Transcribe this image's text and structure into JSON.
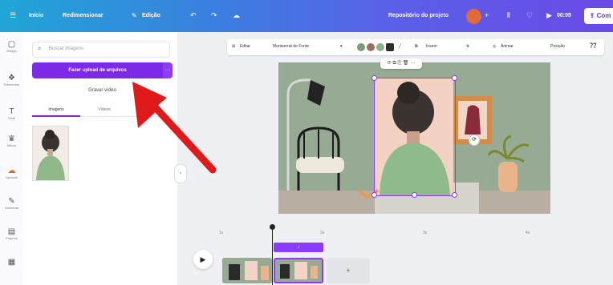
{
  "topbar": {
    "home": "Início",
    "resize": "Redimensionar",
    "edit_mode": "Edição",
    "title": "Repositório do projeto",
    "plus": "+",
    "play_label": "00:05",
    "share": "Com"
  },
  "rail": [
    {
      "icon": "design-icon",
      "glyph": "▢",
      "label": "Design"
    },
    {
      "icon": "elements-icon",
      "glyph": "❖",
      "label": "Elementos"
    },
    {
      "icon": "text-icon",
      "glyph": "T",
      "label": "Texto"
    },
    {
      "icon": "brand-icon",
      "glyph": "♛",
      "label": "Marca"
    },
    {
      "icon": "uploads-icon",
      "glyph": "☁",
      "label": "Uploads"
    },
    {
      "icon": "draw-icon",
      "glyph": "✎",
      "label": "Desenhar"
    },
    {
      "icon": "projects-icon",
      "glyph": "▤",
      "label": "Projetos"
    },
    {
      "icon": "apps-icon",
      "glyph": "▦",
      "label": ""
    }
  ],
  "panel": {
    "search_placeholder": "Buscar imagens",
    "upload_label": "Fazer upload de arquivos",
    "upload_more": "···",
    "record_label": "Gravar vídeo",
    "tabs": [
      "Imagens",
      "Vídeos"
    ]
  },
  "toolbar": {
    "edit": "Editar",
    "font": "Montserrat de Fonte",
    "animate": "Animar",
    "position": "Posição",
    "swatches": [
      "#7c9b7a",
      "#9a6f62",
      "#8fb08c",
      "#2d2d2d"
    ]
  },
  "canvas": {
    "wall": "#97ab94",
    "floor": "#b9aea2",
    "selection_tools": "⟳ ⧉ ⎘ 🗑 ···"
  },
  "timeline": {
    "ticks": [
      "1s",
      "2s",
      "3s",
      "4s"
    ],
    "clip_label": "♪",
    "add_clip": "+",
    "play": "▶"
  }
}
